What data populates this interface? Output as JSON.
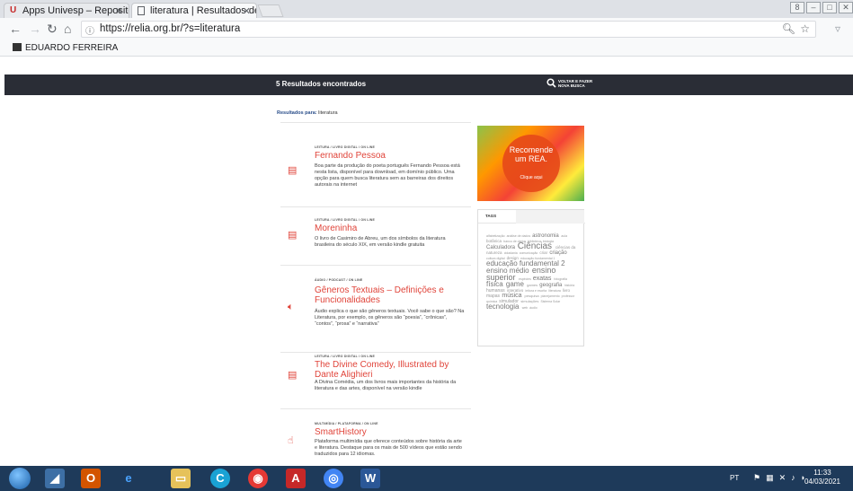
{
  "browser": {
    "tabs": [
      {
        "label": "Apps Univesp – Repositó",
        "icon": "univesp-logo-icon"
      },
      {
        "label": "literatura | Resultados dé",
        "icon": "page-icon"
      }
    ],
    "window_controls": [
      "8",
      "–",
      "□",
      "✕"
    ],
    "url": "https://relia.org.br/?s=literatura",
    "bookmark_label": "EDUARDO FERREIRA"
  },
  "site": {
    "results_count_label": "5 Resultados encontrados",
    "back_label_1": "VOLTAR E FAZER",
    "back_label_2": "NOVA BUSCA",
    "results_for_label": "Resultados para:",
    "results_for_query": "literatura",
    "results": [
      {
        "category": "LEITURA / LIVRO DIGITAL / ON LINE",
        "title": "Fernando Pessoa",
        "description": "Boa parte da produção do poeta português Fernando Pessoa está nesta lista, disponível para download, em domínio público. Uma opção para quem busca literatura sem as barreiras dos direitos autorais na internet",
        "icon": "book-icon"
      },
      {
        "category": "LEITURA / LIVRO DIGITAL / ON LINE",
        "title": "Moreninha",
        "description": "O livro de Casimiro de Abreu, um dos símbolos da literatura brasileira do século XIX, em versão kindle gratuita",
        "icon": "book-icon"
      },
      {
        "category": "ÁUDIO / PODCAST / ON LINE",
        "title": "Gêneros Textuais – Definições e Funcionalidades",
        "description": "Áudio explica o que são gêneros textuais. Você sabe o que são? Na Literatura, por exemplo, os gêneros são “poesia”, “crônicas”, “contos”, “prosa” e “narrativa”",
        "icon": "speaker-icon"
      },
      {
        "category": "LEITURA / LIVRO DIGITAL / ON LINE",
        "title": "The Divine Comedy, Illustrated by Dante Alighieri",
        "description": "A Divina Comédia, um dos livros mais importantes da história da literatura e das artes, disponível na versão kindle",
        "icon": "book-icon"
      },
      {
        "category": "MULTIMÍDIA / PLATAFORMA / ON LINE",
        "title": "SmartHistory",
        "description": "Plataforma multimídia que oferece conteúdos sobre história da arte e literatura. Destaque para os mais de 500 vídeos que estão sendo traduzidos para 12 idiomas.",
        "icon": "hand-pointer-icon"
      }
    ],
    "promo": {
      "title_1": "Recomende",
      "title_2": "um REA.",
      "cta": "Clique aqui"
    },
    "tags_title": "TAGS",
    "tags": [
      {
        "t": "alfabetização",
        "s": 3.5
      },
      {
        "t": "análise de dados",
        "s": 3.5
      },
      {
        "t": "astronomia",
        "s": 6
      },
      {
        "t": "aula",
        "s": 3.5
      },
      {
        "t": "botânica",
        "s": 4.5
      },
      {
        "t": "banco de dados",
        "s": 3.5
      },
      {
        "t": "biblioteca",
        "s": 3.5
      },
      {
        "t": "biologia",
        "s": 3.5
      },
      {
        "t": "Calculadora",
        "s": 6
      },
      {
        "t": "Ciências",
        "s": 10
      },
      {
        "t": "ciências da natureza",
        "s": 4.5
      },
      {
        "t": "cidadania",
        "s": 3.5
      },
      {
        "t": "comunicação",
        "s": 3.5
      },
      {
        "t": "criar",
        "s": 4.5
      },
      {
        "t": "criação",
        "s": 6
      },
      {
        "t": "cultura digital",
        "s": 3.5
      },
      {
        "t": "design",
        "s": 4.5
      },
      {
        "t": "educação fundamental 1",
        "s": 3.5
      },
      {
        "t": "educação fundamental 2",
        "s": 8
      },
      {
        "t": "ensino médio",
        "s": 8
      },
      {
        "t": "ensino superior",
        "s": 9
      },
      {
        "t": "espécies",
        "s": 3.5
      },
      {
        "t": "exatas",
        "s": 7
      },
      {
        "t": "fotografia",
        "s": 3.5
      },
      {
        "t": "física",
        "s": 8
      },
      {
        "t": "game",
        "s": 8
      },
      {
        "t": "games",
        "s": 4
      },
      {
        "t": "geografia",
        "s": 6
      },
      {
        "t": "história",
        "s": 3.5
      },
      {
        "t": "humanas",
        "s": 5
      },
      {
        "t": "interativo",
        "s": 4.5
      },
      {
        "t": "leitura e escrita",
        "s": 3.5
      },
      {
        "t": "literatura",
        "s": 3.5
      },
      {
        "t": "livro",
        "s": 4.5
      },
      {
        "t": "mapas",
        "s": 5
      },
      {
        "t": "música",
        "s": 7
      },
      {
        "t": "pesquisa",
        "s": 4
      },
      {
        "t": "planejamento",
        "s": 3.5
      },
      {
        "t": "professor",
        "s": 3.5
      },
      {
        "t": "química",
        "s": 3.5
      },
      {
        "t": "simulador",
        "s": 5
      },
      {
        "t": "simulações",
        "s": 4
      },
      {
        "t": "Sistema Solar",
        "s": 3.5
      },
      {
        "t": "tecnologia",
        "s": 8
      },
      {
        "t": "web",
        "s": 3.5
      },
      {
        "t": "áudio",
        "s": 3.5
      }
    ]
  },
  "taskbar": {
    "lang": "PT",
    "time": "11:33",
    "date": "04/03/2021"
  }
}
